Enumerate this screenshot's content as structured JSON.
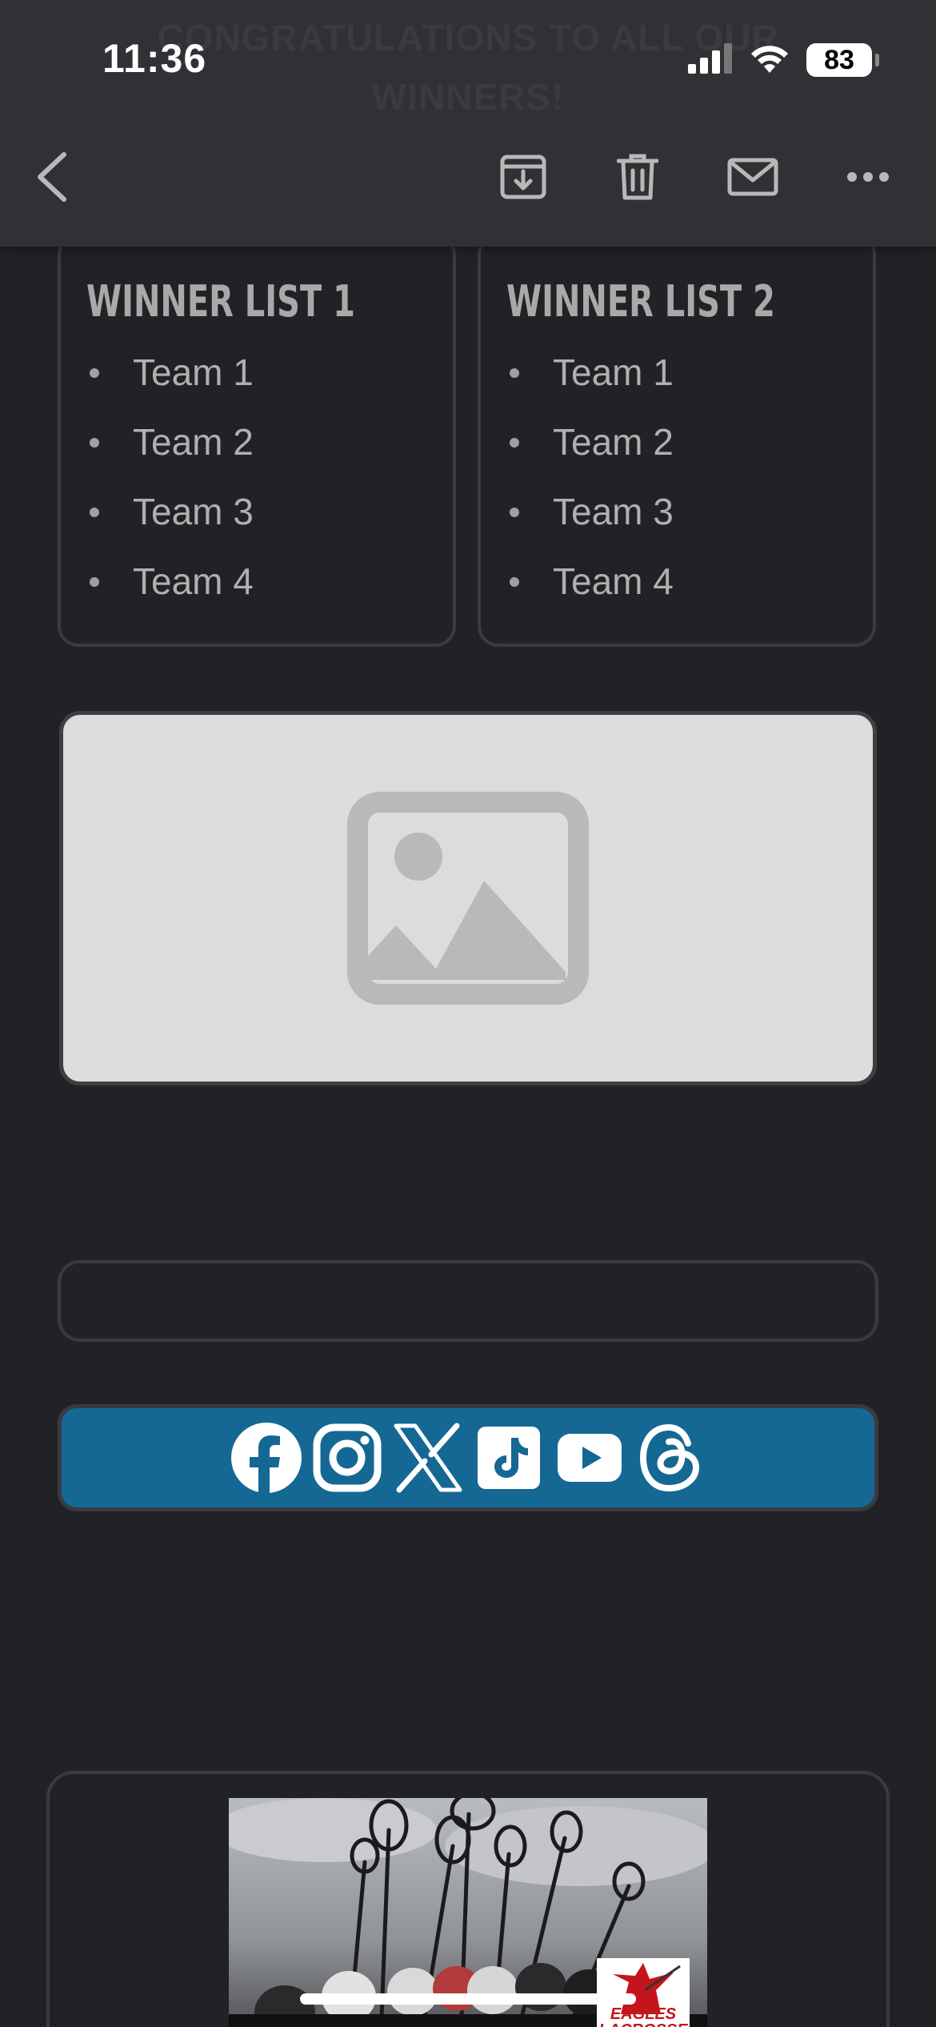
{
  "status_bar": {
    "time": "11:36",
    "battery": "83"
  },
  "background_heading": "CONGRATULATIONS TO ALL OUR WINNERS!",
  "toolbar": {
    "icons": [
      "back-icon",
      "archive-icon",
      "trash-icon",
      "mail-icon",
      "more-icon"
    ]
  },
  "winner_lists": [
    {
      "title": "WINNER LIST 1",
      "items": [
        "Team 1",
        "Team 2",
        "Team 3",
        "Team 4"
      ]
    },
    {
      "title": "WINNER LIST 2",
      "items": [
        "Team 1",
        "Team 2",
        "Team 3",
        "Team 4"
      ]
    }
  ],
  "image_placeholder": {
    "icon": "image-placeholder-icon"
  },
  "social_links": {
    "background_color": "#156893",
    "icons": [
      "facebook-icon",
      "instagram-icon",
      "x-icon",
      "tiktok-icon",
      "youtube-icon",
      "threads-icon"
    ]
  },
  "team_photo": {
    "logo_text": "EAGLES LACROSSE"
  },
  "colors": {
    "background": "#212226",
    "toolbar": "#303135",
    "card_border": "#3a3b3f",
    "placeholder_bg": "#dcdcdc"
  }
}
